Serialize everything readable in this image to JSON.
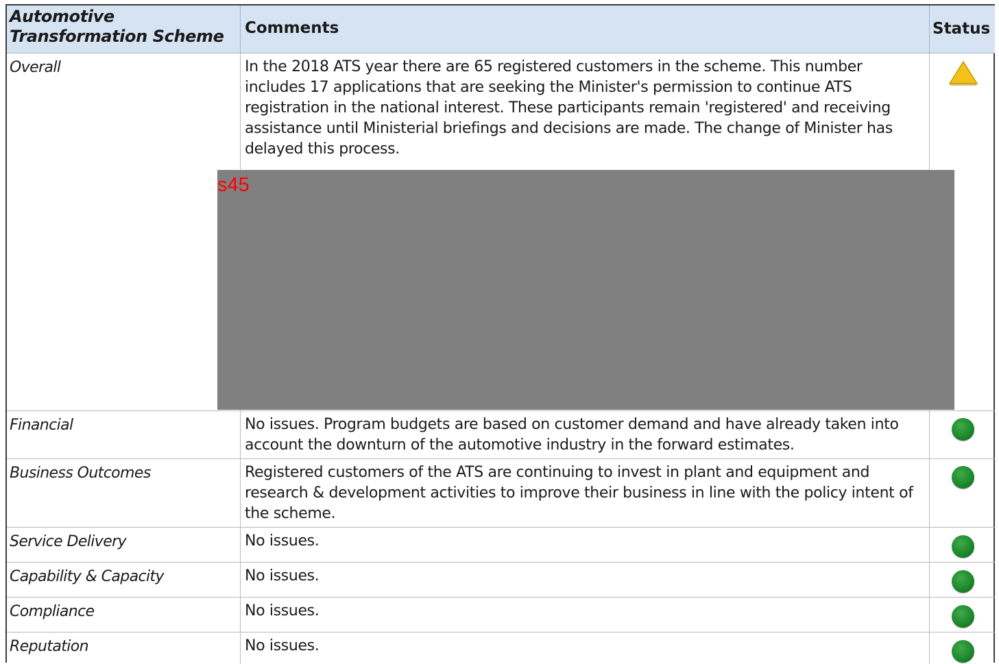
{
  "header": {
    "scheme_line1": "Automotive",
    "scheme_line2": "Transformation Scheme",
    "comments": "Comments",
    "status": "Status"
  },
  "rows": [
    {
      "label": "Overall",
      "comment": "In the 2018 ATS year there are 65 registered customers in the scheme. This number includes 17 applications that are seeking the Minister's permission to continue ATS registration in the national interest. These participants remain 'registered' and receiving assistance until Ministerial briefings and decisions are made. The change of Minister has delayed this process.",
      "status": "amber"
    },
    {
      "label": "Financial",
      "comment": "No issues. Program budgets are based on customer demand and have already taken into account the downturn of the automotive industry in the forward estimates.",
      "status": "green"
    },
    {
      "label": "Business Outcomes",
      "comment": "Registered customers of the ATS are continuing to invest in plant and equipment and research & development activities to improve their business in line with the policy intent of the scheme.",
      "status": "green"
    },
    {
      "label": "Service Delivery",
      "comment": "No issues.",
      "status": "green"
    },
    {
      "label": "Capability & Capacity",
      "comment": "No issues.",
      "status": "green"
    },
    {
      "label": "Compliance",
      "comment": "No issues.",
      "status": "green"
    },
    {
      "label": "Reputation",
      "comment": "No issues.",
      "status": "green"
    }
  ],
  "redaction": {
    "label": "s45",
    "color": "#808080",
    "label_color": "#ff0000"
  },
  "status_colors": {
    "green": "#1e8a2c",
    "amber": "#f2c218"
  }
}
